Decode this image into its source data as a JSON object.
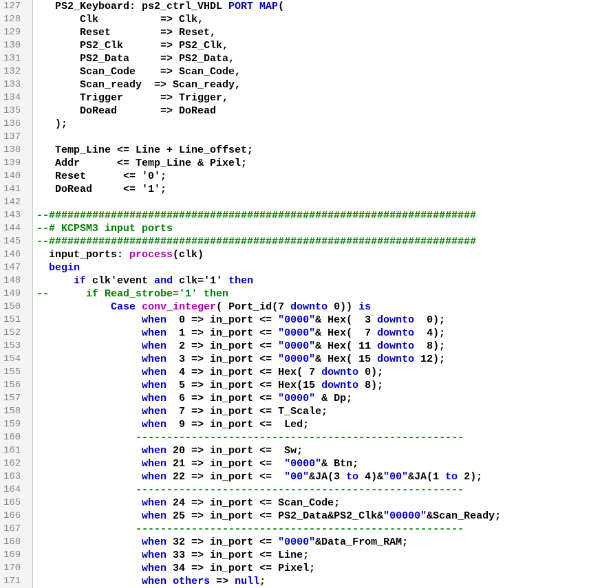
{
  "editor": {
    "language": "VHDL",
    "colors": {
      "keyword": "#0000c8",
      "function": "#b000b0",
      "comment": "#008000",
      "string": "#0000c8",
      "text": "#000000",
      "line_number": "#8a8a8a",
      "gutter_bg": "#f4f4f4"
    },
    "lines": [
      {
        "n": "127",
        "segs": [
          [
            "   PS2_Keyboard: ps2_ctrl_VHDL ",
            ""
          ],
          [
            "PORT MAP",
            "kw"
          ],
          [
            "(",
            ""
          ]
        ]
      },
      {
        "n": "128",
        "segs": [
          [
            "       Clk          => Clk,",
            ""
          ]
        ]
      },
      {
        "n": "129",
        "segs": [
          [
            "       Reset        => Reset,",
            ""
          ]
        ]
      },
      {
        "n": "130",
        "segs": [
          [
            "       PS2_Clk      => PS2_Clk,",
            ""
          ]
        ]
      },
      {
        "n": "131",
        "segs": [
          [
            "       PS2_Data     => PS2_Data,",
            ""
          ]
        ]
      },
      {
        "n": "132",
        "segs": [
          [
            "       Scan_Code    => Scan_Code,",
            ""
          ]
        ]
      },
      {
        "n": "133",
        "segs": [
          [
            "       Scan_ready  => Scan_ready,",
            ""
          ]
        ]
      },
      {
        "n": "134",
        "segs": [
          [
            "       Trigger      => Trigger,",
            ""
          ]
        ]
      },
      {
        "n": "135",
        "segs": [
          [
            "       DoRead       => DoRead",
            ""
          ]
        ]
      },
      {
        "n": "136",
        "segs": [
          [
            "   );",
            ""
          ]
        ]
      },
      {
        "n": "137",
        "segs": []
      },
      {
        "n": "138",
        "segs": [
          [
            "   Temp_Line <= Line + Line_offset;",
            ""
          ]
        ]
      },
      {
        "n": "139",
        "segs": [
          [
            "   Addr      <= Temp_Line & Pixel;",
            ""
          ]
        ]
      },
      {
        "n": "140",
        "segs": [
          [
            "   Reset      <= '0';",
            ""
          ]
        ]
      },
      {
        "n": "141",
        "segs": [
          [
            "   DoRead     <= '1';",
            ""
          ]
        ]
      },
      {
        "n": "142",
        "segs": []
      },
      {
        "n": "143",
        "segs": [
          [
            "--#####################################################################",
            "cm"
          ]
        ]
      },
      {
        "n": "144",
        "segs": [
          [
            "--# KCPSM3 input ports",
            "cm"
          ]
        ]
      },
      {
        "n": "145",
        "segs": [
          [
            "--#####################################################################",
            "cm"
          ]
        ]
      },
      {
        "n": "146",
        "segs": [
          [
            "  input_ports: ",
            ""
          ],
          [
            "process",
            "fn"
          ],
          [
            "(clk)",
            ""
          ]
        ]
      },
      {
        "n": "147",
        "segs": [
          [
            "  ",
            ""
          ],
          [
            "begin",
            "kw"
          ]
        ]
      },
      {
        "n": "148",
        "segs": [
          [
            "      ",
            ""
          ],
          [
            "if",
            "kw"
          ],
          [
            " clk'event ",
            ""
          ],
          [
            "and",
            "kw"
          ],
          [
            " clk='1' ",
            ""
          ],
          [
            "then",
            "kw"
          ]
        ]
      },
      {
        "n": "149",
        "segs": [
          [
            "--      if Read_strobe='1' then",
            "cm"
          ]
        ]
      },
      {
        "n": "150",
        "segs": [
          [
            "            ",
            ""
          ],
          [
            "Case",
            "kw"
          ],
          [
            " ",
            ""
          ],
          [
            "conv_integer",
            "fn"
          ],
          [
            "( Port_id(7 ",
            ""
          ],
          [
            "downto",
            "kw"
          ],
          [
            " 0)) ",
            ""
          ],
          [
            "is",
            "kw"
          ]
        ]
      },
      {
        "n": "151",
        "segs": [
          [
            "                 ",
            ""
          ],
          [
            "when",
            "kw"
          ],
          [
            "  0 => in_port <= ",
            ""
          ],
          [
            "\"0000\"",
            "st"
          ],
          [
            "& Hex(  3 ",
            ""
          ],
          [
            "downto",
            "kw"
          ],
          [
            "  0);",
            ""
          ]
        ]
      },
      {
        "n": "152",
        "segs": [
          [
            "                 ",
            ""
          ],
          [
            "when",
            "kw"
          ],
          [
            "  1 => in_port <= ",
            ""
          ],
          [
            "\"0000\"",
            "st"
          ],
          [
            "& Hex(  7 ",
            ""
          ],
          [
            "downto",
            "kw"
          ],
          [
            "  4);",
            ""
          ]
        ]
      },
      {
        "n": "153",
        "segs": [
          [
            "                 ",
            ""
          ],
          [
            "when",
            "kw"
          ],
          [
            "  2 => in_port <= ",
            ""
          ],
          [
            "\"0000\"",
            "st"
          ],
          [
            "& Hex( 11 ",
            ""
          ],
          [
            "downto",
            "kw"
          ],
          [
            "  8);",
            ""
          ]
        ]
      },
      {
        "n": "154",
        "segs": [
          [
            "                 ",
            ""
          ],
          [
            "when",
            "kw"
          ],
          [
            "  3 => in_port <= ",
            ""
          ],
          [
            "\"0000\"",
            "st"
          ],
          [
            "& Hex( 15 ",
            ""
          ],
          [
            "downto",
            "kw"
          ],
          [
            " 12);",
            ""
          ]
        ]
      },
      {
        "n": "155",
        "segs": [
          [
            "                 ",
            ""
          ],
          [
            "when",
            "kw"
          ],
          [
            "  4 => in_port <= Hex( 7 ",
            ""
          ],
          [
            "downto",
            "kw"
          ],
          [
            " 0);",
            ""
          ]
        ]
      },
      {
        "n": "156",
        "segs": [
          [
            "                 ",
            ""
          ],
          [
            "when",
            "kw"
          ],
          [
            "  5 => in_port <= Hex(15 ",
            ""
          ],
          [
            "downto",
            "kw"
          ],
          [
            " 8);",
            ""
          ]
        ]
      },
      {
        "n": "157",
        "segs": [
          [
            "                 ",
            ""
          ],
          [
            "when",
            "kw"
          ],
          [
            "  6 => in_port <= ",
            ""
          ],
          [
            "\"0000\"",
            "st"
          ],
          [
            " & Dp;",
            ""
          ]
        ]
      },
      {
        "n": "158",
        "segs": [
          [
            "                 ",
            ""
          ],
          [
            "when",
            "kw"
          ],
          [
            "  7 => in_port <= T_Scale;",
            ""
          ]
        ]
      },
      {
        "n": "159",
        "segs": [
          [
            "                 ",
            ""
          ],
          [
            "when",
            "kw"
          ],
          [
            "  9 => in_port <=  Led;",
            ""
          ]
        ]
      },
      {
        "n": "160",
        "segs": [
          [
            "                -----------------------------------------------------",
            "cm"
          ]
        ]
      },
      {
        "n": "161",
        "segs": [
          [
            "                 ",
            ""
          ],
          [
            "when",
            "kw"
          ],
          [
            " 20 => in_port <=  Sw;",
            ""
          ]
        ]
      },
      {
        "n": "162",
        "segs": [
          [
            "                 ",
            ""
          ],
          [
            "when",
            "kw"
          ],
          [
            " 21 => in_port <=  ",
            ""
          ],
          [
            "\"0000\"",
            "st"
          ],
          [
            "& Btn;",
            ""
          ]
        ]
      },
      {
        "n": "163",
        "segs": [
          [
            "                 ",
            ""
          ],
          [
            "when",
            "kw"
          ],
          [
            " 22 => in_port <=  ",
            ""
          ],
          [
            "\"00\"",
            "st"
          ],
          [
            "&JA(3 ",
            ""
          ],
          [
            "to",
            "kw"
          ],
          [
            " 4)&",
            ""
          ],
          [
            "\"00\"",
            "st"
          ],
          [
            "&JA(1 ",
            ""
          ],
          [
            "to",
            "kw"
          ],
          [
            " 2);",
            ""
          ]
        ]
      },
      {
        "n": "164",
        "segs": [
          [
            "                -----------------------------------------------------",
            "cm"
          ]
        ]
      },
      {
        "n": "165",
        "segs": [
          [
            "                 ",
            ""
          ],
          [
            "when",
            "kw"
          ],
          [
            " 24 => in_port <= Scan_Code;",
            ""
          ]
        ]
      },
      {
        "n": "166",
        "segs": [
          [
            "                 ",
            ""
          ],
          [
            "when",
            "kw"
          ],
          [
            " 25 => in_port <= PS2_Data&PS2_Clk&",
            ""
          ],
          [
            "\"00000\"",
            "st"
          ],
          [
            "&Scan_Ready;",
            ""
          ]
        ]
      },
      {
        "n": "167",
        "segs": [
          [
            "                -----------------------------------------------------",
            "cm"
          ]
        ]
      },
      {
        "n": "168",
        "segs": [
          [
            "                 ",
            ""
          ],
          [
            "when",
            "kw"
          ],
          [
            " 32 => in_port <= ",
            ""
          ],
          [
            "\"0000\"",
            "st"
          ],
          [
            "&Data_From_RAM;",
            ""
          ]
        ]
      },
      {
        "n": "169",
        "segs": [
          [
            "                 ",
            ""
          ],
          [
            "when",
            "kw"
          ],
          [
            " 33 => in_port <= Line;",
            ""
          ]
        ]
      },
      {
        "n": "170",
        "segs": [
          [
            "                 ",
            ""
          ],
          [
            "when",
            "kw"
          ],
          [
            " 34 => in_port <= Pixel;",
            ""
          ]
        ]
      },
      {
        "n": "171",
        "segs": [
          [
            "                 ",
            ""
          ],
          [
            "when",
            "kw"
          ],
          [
            " ",
            ""
          ],
          [
            "others",
            "kw"
          ],
          [
            " => ",
            ""
          ],
          [
            "null",
            "kw"
          ],
          [
            ";",
            ""
          ]
        ]
      }
    ]
  }
}
